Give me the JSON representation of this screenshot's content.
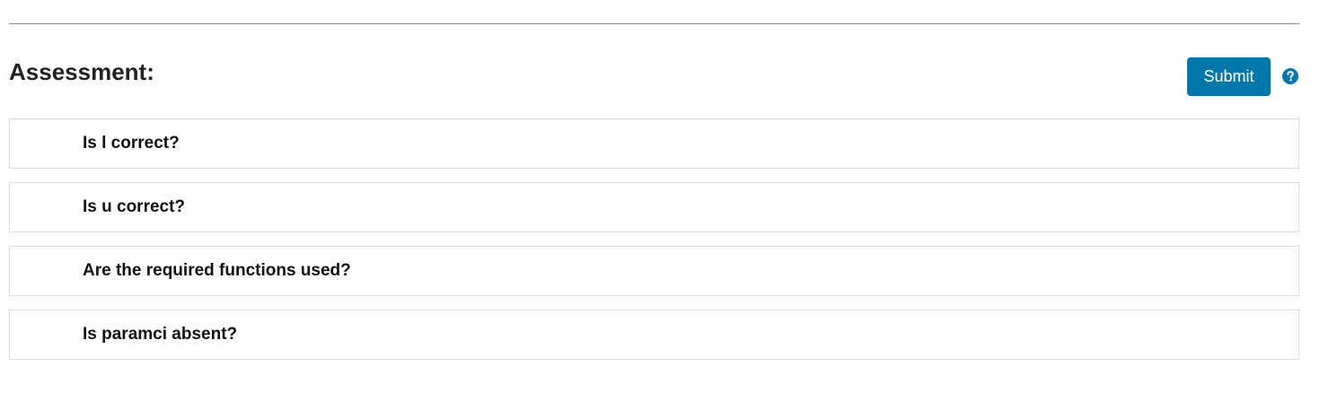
{
  "assessment": {
    "title": "Assessment:",
    "submit_label": "Submit",
    "help_icon": "question-circle-icon",
    "accent_color": "#0077a8",
    "questions": [
      {
        "label": "Is l correct?"
      },
      {
        "label": "Is u correct?"
      },
      {
        "label": "Are the required functions used?"
      },
      {
        "label": "Is paramci absent?"
      }
    ]
  }
}
